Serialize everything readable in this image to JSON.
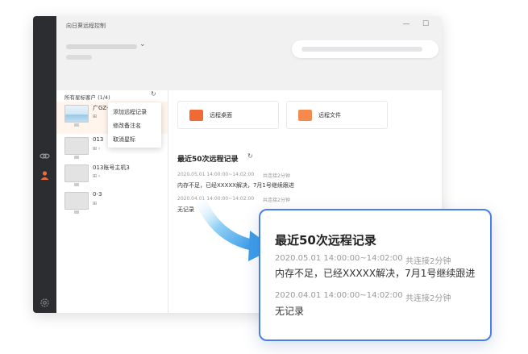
{
  "window": {
    "title": "向日葵远程控制",
    "controls": {
      "minimize": "—",
      "maximize": "☐",
      "close": "✕"
    }
  },
  "left_panel": {
    "header": "所有星标客户 (1/4)",
    "refresh": "↻",
    "devices": [
      {
        "name": "广GZ-win10-test",
        "selected": true
      },
      {
        "name": "013"
      },
      {
        "name": "013账号主机3"
      },
      {
        "name": "0-3"
      }
    ]
  },
  "context_menu": {
    "items": [
      "添加远程记录",
      "修改备注名",
      "取消星标"
    ]
  },
  "main": {
    "tiles": [
      {
        "label": "远程桌面"
      },
      {
        "label": "远程文件"
      }
    ],
    "records": {
      "title": "最近50次远程记录",
      "refresh": "↻",
      "entries": [
        {
          "time": "2020.05.01  14:00:00~14:02:00",
          "duration": "共连接2分钟",
          "note": "内存不足，已经XXXXX解决，7月1号继续跟进"
        },
        {
          "time": "2020.04.01  14:00:00~14:02:00",
          "duration": "共连接2分钟",
          "note": "无记录"
        }
      ]
    }
  },
  "callout": {
    "title": "最近50次远程记录",
    "entries": [
      {
        "time": "2020.05.01   14:00:00~14:02:00",
        "duration": "共连接2分钟",
        "note": "内存不足，已经XXXXX解决，7月1号继续跟进"
      },
      {
        "time": "2020.04.01   14:00:00~14:02:00",
        "duration": "共连接2分钟",
        "note": "无记录"
      }
    ]
  },
  "colors": {
    "accent": "#f06a35",
    "rail": "#2b2d30",
    "callout_border": "#4a7fe8",
    "arrow": "#5ab0f0"
  }
}
